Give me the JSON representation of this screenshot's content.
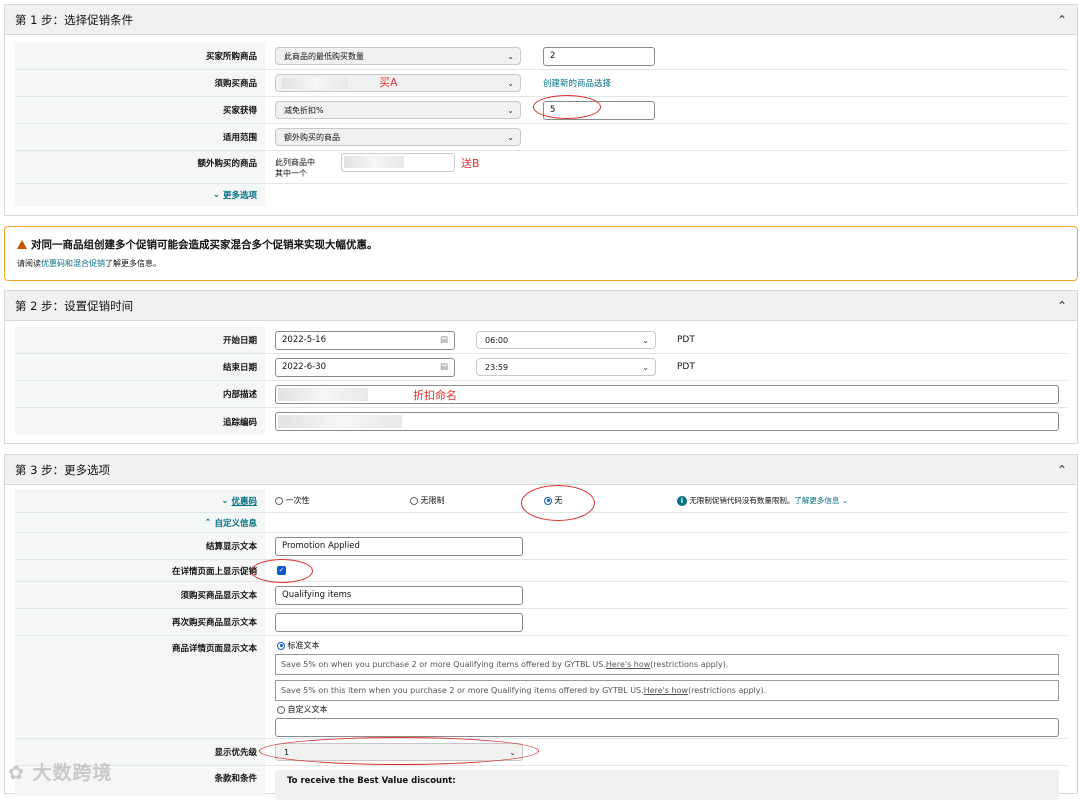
{
  "step1": {
    "title": "第 1 步：选择促销条件",
    "rows": {
      "buyer_buys_label": "买家所购商品",
      "buyer_buys_select": "此商品的最低购买数量",
      "buyer_buys_value": "2",
      "required_label": "须购买商品",
      "required_link": "创建新的商品选择",
      "buyer_gets_label": "买家获得",
      "buyer_gets_select": "减免折扣%",
      "buyer_gets_value": "5",
      "applies_label": "适用范围",
      "applies_select": "额外购买的商品",
      "extra_label": "额外购买的商品",
      "extra_text_1": "此列商品中",
      "extra_text_2": "其中一个",
      "more_options": "更多选项"
    },
    "notes": {
      "buy_a": "买A",
      "gift_b": "送B"
    }
  },
  "warning": {
    "title": "对同一商品组创建多个促销可能会造成买家混合多个促销来实现大幅优惠。",
    "pre": "请阅读",
    "link": "优惠码和混合促销",
    "post": "了解更多信息。"
  },
  "step2": {
    "title": "第 2 步：设置促销时间",
    "start_label": "开始日期",
    "start_date": "2022-5-16",
    "start_time": "06:00",
    "end_label": "结束日期",
    "end_date": "2022-6-30",
    "end_time": "23:59",
    "tz": "PDT",
    "desc_label": "内部描述",
    "desc_note": "折扣命名",
    "track_label": "追踪编码"
  },
  "step3": {
    "title": "第 3 步：更多选项",
    "coupon_label": "优惠码",
    "coupon_options": [
      "一次性",
      "无限制",
      "无"
    ],
    "coupon_info": "无限制促销代码没有数量限制。",
    "coupon_info_link": "了解更多信息",
    "custom_label": "自定义信息",
    "checkout_label": "结算显示文本",
    "checkout_value": "Promotion Applied",
    "show_detail_label": "在详情页面上显示促销",
    "qualifying_label": "须购买商品显示文本",
    "qualifying_value": "Qualifying items",
    "repeat_label": "再次购买商品显示文本",
    "detail_label": "商品详情页面显示文本",
    "standard_text": "标准文本",
    "line1_pre": "Save 5% on when you purchase 2 or more Qualifying items offered by GYTBL US. ",
    "line1_link": "Here's how",
    "line1_post": " (restrictions apply).",
    "line2_pre": "Save 5% on this item when you purchase 2 or more Qualifying items offered by GYTBL US. ",
    "line2_link": "Here's how",
    "line2_post": " (restrictions apply).",
    "custom_text": "自定义文本",
    "priority_label": "显示优先级",
    "priority_value": "1",
    "terms_label": "条款和条件",
    "terms_heading": "To receive the Best Value discount:"
  },
  "watermark": "大数跨境",
  "colors": {
    "link": "#007185",
    "annotation_red": "#d9302c",
    "warning_border": "#f5a623",
    "radio_blue": "#0a58ca"
  }
}
